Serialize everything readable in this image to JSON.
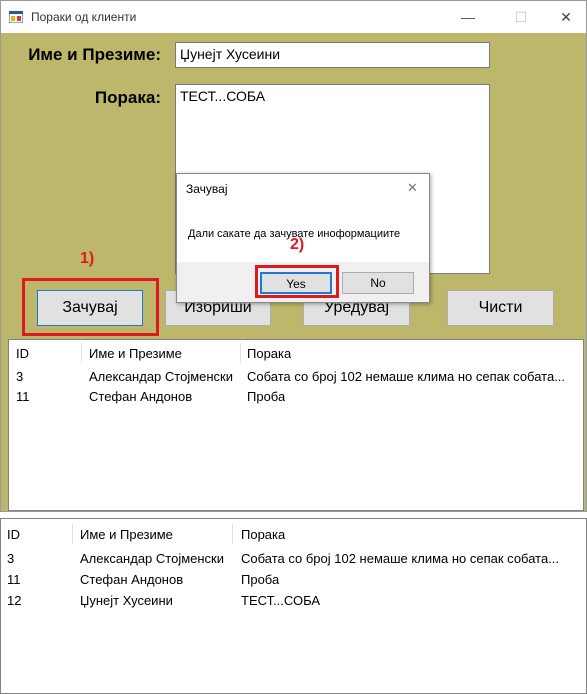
{
  "window": {
    "title": "Пораки од клиенти",
    "minimize": "—",
    "maximize": "☐",
    "close": "✕"
  },
  "form": {
    "name_label": "Име и Презиме:",
    "name_value": "Џунејт Хусеини",
    "message_label": "Порака:",
    "message_value": "ТЕСТ...СОБА"
  },
  "buttons": {
    "save": "Зачувај",
    "delete": "Избриши",
    "edit": "Уредувај",
    "clear": "Чисти"
  },
  "dialog": {
    "title": "Зачувај",
    "close": "✕",
    "message": "Дали сакате да зачувате иноформациите",
    "yes": "Yes",
    "no": "No"
  },
  "annotations": {
    "step1": "1)",
    "step2": "2)",
    "highlight_color": "#e0191f"
  },
  "table_top": {
    "columns": [
      "ID",
      "Име и Презиме",
      "Порака"
    ],
    "rows": [
      [
        "3",
        "Александар Стојменски",
        "Собата со број 102 немаше клима но сепак собата..."
      ],
      [
        "11",
        "Стефан Андонов",
        "Проба"
      ]
    ]
  },
  "table_bottom": {
    "columns": [
      "ID",
      "Име и Презиме",
      "Порака"
    ],
    "rows": [
      [
        "3",
        "Александар Стојменски",
        "Собата со број 102 немаше клима но сепак собата..."
      ],
      [
        "11",
        "Стефан Андонов",
        "Проба"
      ],
      [
        "12",
        "Џунејт Хусеини",
        "ТЕСТ...СОБА"
      ]
    ]
  },
  "colors": {
    "form_background": "#bdb76b",
    "annotation_red": "#e0191f"
  }
}
